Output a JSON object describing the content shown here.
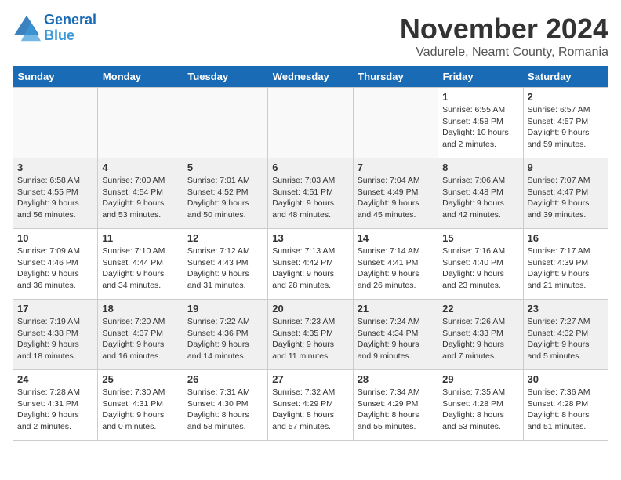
{
  "header": {
    "logo_line1": "General",
    "logo_line2": "Blue",
    "title": "November 2024",
    "subtitle": "Vadurele, Neamt County, Romania"
  },
  "days_of_week": [
    "Sunday",
    "Monday",
    "Tuesday",
    "Wednesday",
    "Thursday",
    "Friday",
    "Saturday"
  ],
  "weeks": [
    [
      {
        "day": "",
        "info": ""
      },
      {
        "day": "",
        "info": ""
      },
      {
        "day": "",
        "info": ""
      },
      {
        "day": "",
        "info": ""
      },
      {
        "day": "",
        "info": ""
      },
      {
        "day": "1",
        "info": "Sunrise: 6:55 AM\nSunset: 4:58 PM\nDaylight: 10 hours and 2 minutes."
      },
      {
        "day": "2",
        "info": "Sunrise: 6:57 AM\nSunset: 4:57 PM\nDaylight: 9 hours and 59 minutes."
      }
    ],
    [
      {
        "day": "3",
        "info": "Sunrise: 6:58 AM\nSunset: 4:55 PM\nDaylight: 9 hours and 56 minutes."
      },
      {
        "day": "4",
        "info": "Sunrise: 7:00 AM\nSunset: 4:54 PM\nDaylight: 9 hours and 53 minutes."
      },
      {
        "day": "5",
        "info": "Sunrise: 7:01 AM\nSunset: 4:52 PM\nDaylight: 9 hours and 50 minutes."
      },
      {
        "day": "6",
        "info": "Sunrise: 7:03 AM\nSunset: 4:51 PM\nDaylight: 9 hours and 48 minutes."
      },
      {
        "day": "7",
        "info": "Sunrise: 7:04 AM\nSunset: 4:49 PM\nDaylight: 9 hours and 45 minutes."
      },
      {
        "day": "8",
        "info": "Sunrise: 7:06 AM\nSunset: 4:48 PM\nDaylight: 9 hours and 42 minutes."
      },
      {
        "day": "9",
        "info": "Sunrise: 7:07 AM\nSunset: 4:47 PM\nDaylight: 9 hours and 39 minutes."
      }
    ],
    [
      {
        "day": "10",
        "info": "Sunrise: 7:09 AM\nSunset: 4:46 PM\nDaylight: 9 hours and 36 minutes."
      },
      {
        "day": "11",
        "info": "Sunrise: 7:10 AM\nSunset: 4:44 PM\nDaylight: 9 hours and 34 minutes."
      },
      {
        "day": "12",
        "info": "Sunrise: 7:12 AM\nSunset: 4:43 PM\nDaylight: 9 hours and 31 minutes."
      },
      {
        "day": "13",
        "info": "Sunrise: 7:13 AM\nSunset: 4:42 PM\nDaylight: 9 hours and 28 minutes."
      },
      {
        "day": "14",
        "info": "Sunrise: 7:14 AM\nSunset: 4:41 PM\nDaylight: 9 hours and 26 minutes."
      },
      {
        "day": "15",
        "info": "Sunrise: 7:16 AM\nSunset: 4:40 PM\nDaylight: 9 hours and 23 minutes."
      },
      {
        "day": "16",
        "info": "Sunrise: 7:17 AM\nSunset: 4:39 PM\nDaylight: 9 hours and 21 minutes."
      }
    ],
    [
      {
        "day": "17",
        "info": "Sunrise: 7:19 AM\nSunset: 4:38 PM\nDaylight: 9 hours and 18 minutes."
      },
      {
        "day": "18",
        "info": "Sunrise: 7:20 AM\nSunset: 4:37 PM\nDaylight: 9 hours and 16 minutes."
      },
      {
        "day": "19",
        "info": "Sunrise: 7:22 AM\nSunset: 4:36 PM\nDaylight: 9 hours and 14 minutes."
      },
      {
        "day": "20",
        "info": "Sunrise: 7:23 AM\nSunset: 4:35 PM\nDaylight: 9 hours and 11 minutes."
      },
      {
        "day": "21",
        "info": "Sunrise: 7:24 AM\nSunset: 4:34 PM\nDaylight: 9 hours and 9 minutes."
      },
      {
        "day": "22",
        "info": "Sunrise: 7:26 AM\nSunset: 4:33 PM\nDaylight: 9 hours and 7 minutes."
      },
      {
        "day": "23",
        "info": "Sunrise: 7:27 AM\nSunset: 4:32 PM\nDaylight: 9 hours and 5 minutes."
      }
    ],
    [
      {
        "day": "24",
        "info": "Sunrise: 7:28 AM\nSunset: 4:31 PM\nDaylight: 9 hours and 2 minutes."
      },
      {
        "day": "25",
        "info": "Sunrise: 7:30 AM\nSunset: 4:31 PM\nDaylight: 9 hours and 0 minutes."
      },
      {
        "day": "26",
        "info": "Sunrise: 7:31 AM\nSunset: 4:30 PM\nDaylight: 8 hours and 58 minutes."
      },
      {
        "day": "27",
        "info": "Sunrise: 7:32 AM\nSunset: 4:29 PM\nDaylight: 8 hours and 57 minutes."
      },
      {
        "day": "28",
        "info": "Sunrise: 7:34 AM\nSunset: 4:29 PM\nDaylight: 8 hours and 55 minutes."
      },
      {
        "day": "29",
        "info": "Sunrise: 7:35 AM\nSunset: 4:28 PM\nDaylight: 8 hours and 53 minutes."
      },
      {
        "day": "30",
        "info": "Sunrise: 7:36 AM\nSunset: 4:28 PM\nDaylight: 8 hours and 51 minutes."
      }
    ]
  ]
}
